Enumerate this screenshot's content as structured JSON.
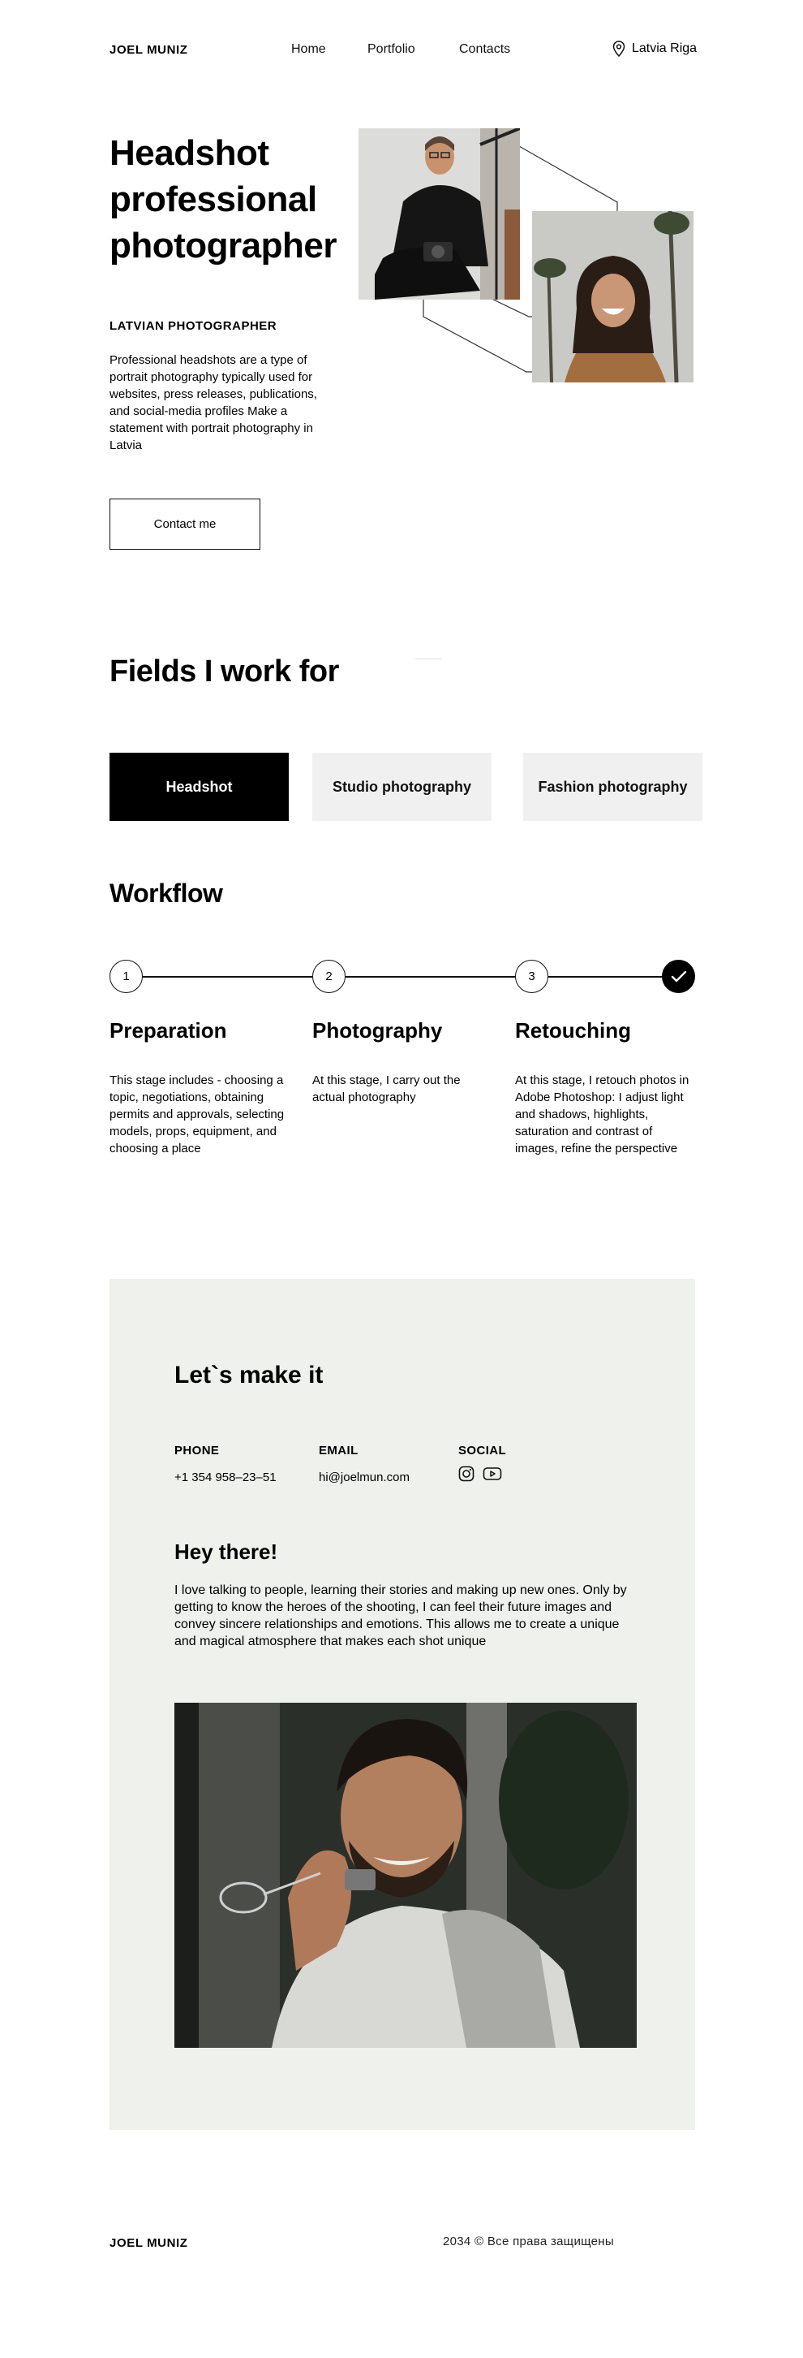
{
  "header": {
    "logo": "JOEL MUNIZ",
    "nav": [
      "Home",
      "Portfolio",
      "Contacts"
    ],
    "location": "Latvia Riga"
  },
  "hero": {
    "title": "Headshot professional photographer",
    "subtitle": "LATVIAN PHOTOGRAPHER",
    "description": "Professional headshots are a type of portrait photography typically used for websites, press releases, publications, and social-media profiles Make a statement with portrait photography in Latvia",
    "cta": "Contact me"
  },
  "fields": {
    "title": "Fields I work for",
    "items": [
      {
        "label": "Headshot",
        "active": true
      },
      {
        "label": "Studio photography",
        "active": false
      },
      {
        "label": "Fashion photography",
        "active": false
      }
    ]
  },
  "workflow": {
    "title": "Workflow",
    "steps": [
      {
        "number": "1",
        "title": "Preparation",
        "description": "This stage includes - choosing a topic, negotiations, obtaining permits and approvals, selecting models, props, equipment, and choosing a place"
      },
      {
        "number": "2",
        "title": "Photography",
        "description": "At this stage, I carry out the actual photography"
      },
      {
        "number": "3",
        "title": "Retouching",
        "description": "At this stage, I retouch photos in Adobe Photoshop: I adjust light and shadows, highlights, saturation and contrast of images, refine the perspective"
      }
    ]
  },
  "contact": {
    "title": "Let`s make it",
    "phone_label": "PHONE",
    "phone": "+1 354 958–23–51",
    "email_label": "EMAIL",
    "email": "hi@joelmun.com",
    "social_label": "SOCIAL",
    "social_icons": [
      "instagram-icon",
      "youtube-icon"
    ],
    "hey_title": "Hey there!",
    "hey_text": "I love talking to people, learning their stories and making up new ones. Only by getting to know the heroes of the shooting, I can feel their future images and convey sincere relationships and emotions. This allows me to create a unique and magical atmosphere that makes each shot unique"
  },
  "footer": {
    "logo": "JOEL MUNIZ",
    "copyright": "2034 © Все права защищены"
  },
  "colors": {
    "panel_bg": "#eef1ec",
    "card_inactive": "#f0f0f0",
    "accent": "#000000"
  }
}
